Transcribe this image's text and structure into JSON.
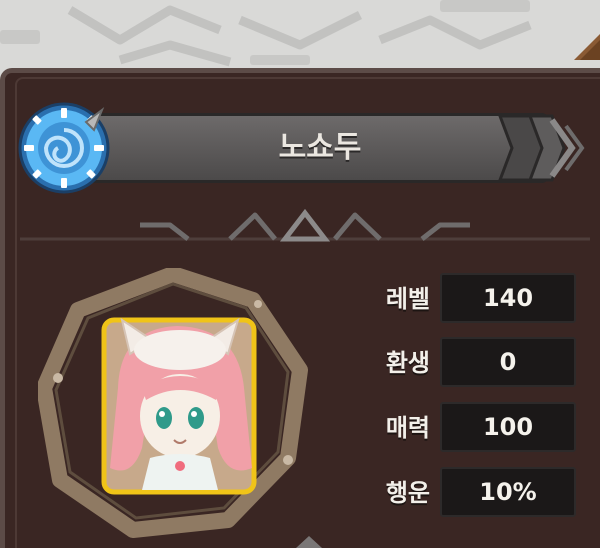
{
  "character": {
    "name": "노쇼두"
  },
  "stats": [
    {
      "label": "레벨",
      "value": "140"
    },
    {
      "label": "환생",
      "value": "0"
    },
    {
      "label": "매력",
      "value": "100"
    },
    {
      "label": "행운",
      "value": "10%"
    }
  ],
  "colors": {
    "panel": "#3a2623",
    "panel_border": "#5c4b47",
    "name_bar": "#5c5a5a",
    "stat_box": "#1b1818",
    "emblem_blue": "#3fa6ee",
    "portrait_frame": "#8f7a63",
    "portrait_border": "#f0c418"
  },
  "icons": {
    "emblem": "blue-swirl-gear-emblem",
    "portrait": "pink-haired-cat-girl-portrait"
  }
}
